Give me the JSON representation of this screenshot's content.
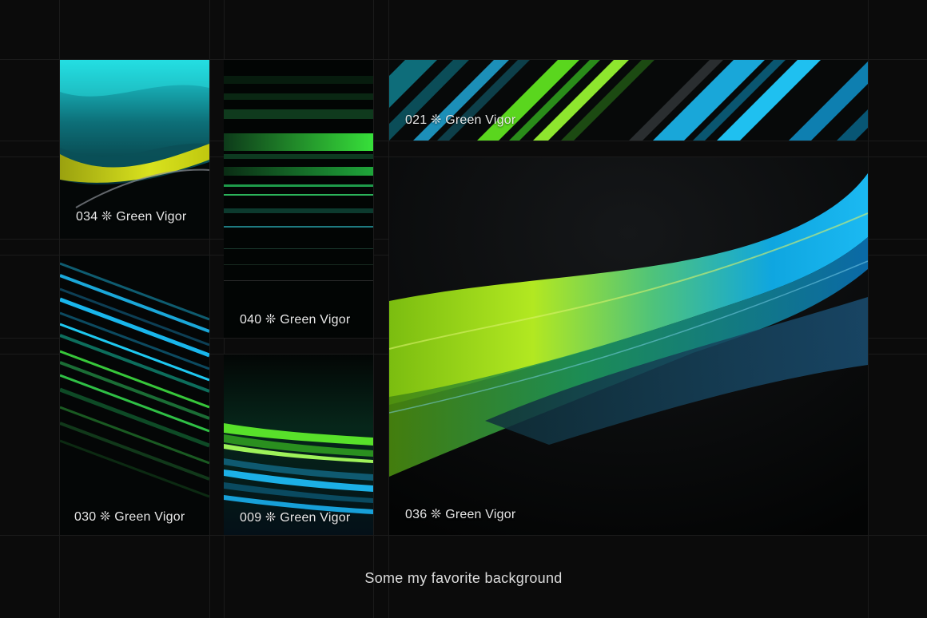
{
  "tiles": [
    {
      "id": "034",
      "caption": "034 ❊ Green Vigor"
    },
    {
      "id": "040",
      "caption": "040 ❊ Green Vigor"
    },
    {
      "id": "021",
      "caption": "021 ❊ Green Vigor"
    },
    {
      "id": "030",
      "caption": "030 ❊ Green Vigor"
    },
    {
      "id": "009",
      "caption": "009 ❊ Green Vigor"
    },
    {
      "id": "036",
      "caption": "036 ❊ Green Vigor"
    }
  ],
  "footer": {
    "text": "Some my favorite background"
  },
  "colors": {
    "background": "#0b0b0b",
    "green": "#7ee22a",
    "lime": "#c9d81a",
    "cyan": "#14b8e6",
    "teal": "#0e6b73"
  }
}
